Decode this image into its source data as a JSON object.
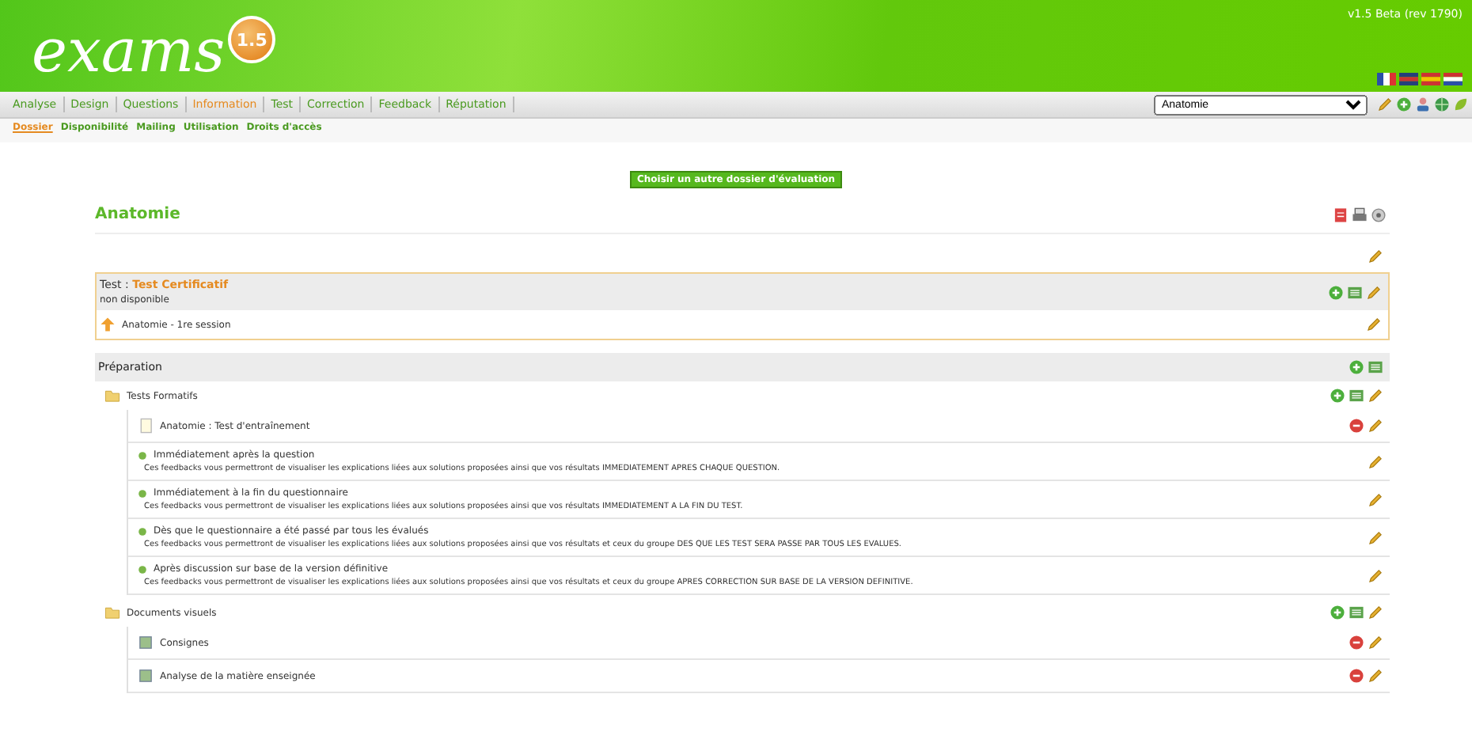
{
  "header": {
    "logo": "exams",
    "version_badge": "1.5",
    "version": "v1.5 Beta (rev 1790)",
    "flags": [
      {
        "kind": "fr"
      },
      {
        "kind": "gb"
      },
      {
        "kind": "es"
      },
      {
        "kind": "nl"
      }
    ]
  },
  "tabs": [
    {
      "label": "Analyse",
      "selected": false
    },
    {
      "label": "Design",
      "selected": false
    },
    {
      "label": "Questions",
      "selected": false
    },
    {
      "label": "Information",
      "selected": true
    },
    {
      "label": "Test",
      "selected": false
    },
    {
      "label": "Correction",
      "selected": false
    },
    {
      "label": "Feedback",
      "selected": false
    },
    {
      "label": "Réputation",
      "selected": false
    }
  ],
  "course_select": {
    "value": "Anatomie"
  },
  "toolbar": [
    {
      "kind": "edit"
    },
    {
      "kind": "add"
    },
    {
      "kind": "user"
    },
    {
      "kind": "globe"
    },
    {
      "kind": "leaf"
    }
  ],
  "subtabs": [
    {
      "label": "Dossier",
      "selected": true
    },
    {
      "label": "Disponibilité",
      "selected": false
    },
    {
      "label": "Mailing",
      "selected": false
    },
    {
      "label": "Utilisation",
      "selected": false
    },
    {
      "label": "Droits d'accès",
      "selected": false
    }
  ],
  "choose_button": "Choisir un autre dossier d'évaluation",
  "title": "Anatomie",
  "title_actions": [
    {
      "kind": "pdf"
    },
    {
      "kind": "print"
    },
    {
      "kind": "view"
    }
  ],
  "test_box": {
    "label": "Test :",
    "name": "Test Certificatif",
    "status": "non disponible",
    "session": "Anatomie - 1re session"
  },
  "preparation": {
    "title": "Préparation",
    "folders": [
      {
        "name": "Tests Formatifs",
        "items": [
          {
            "kind": "test",
            "title": "Anatomie : Test d'entraînement",
            "actions": [
              {
                "kind": "delete"
              },
              {
                "kind": "edit"
              }
            ]
          },
          {
            "kind": "feedback",
            "title": "Immédiatement après la question",
            "description": "Ces feedbacks vous permettront de visualiser les explications liées aux solutions proposées ainsi que vos résultats IMMEDIATEMENT APRES CHAQUE QUESTION.",
            "actions": [
              {
                "kind": "edit"
              }
            ]
          },
          {
            "kind": "feedback",
            "title": "Immédiatement à la fin du questionnaire",
            "description": "Ces feedbacks vous permettront de visualiser les explications liées aux solutions proposées ainsi que vos résultats IMMEDIATEMENT A LA FIN DU TEST.",
            "actions": [
              {
                "kind": "edit"
              }
            ]
          },
          {
            "kind": "feedback",
            "title": "Dès que le questionnaire a été passé par tous les évalués",
            "description": "Ces feedbacks vous permettront de visualiser les explications liées aux solutions proposées ainsi que vos résultats et ceux du groupe DES QUE LES TEST SERA PASSE PAR TOUS LES EVALUES.",
            "actions": [
              {
                "kind": "edit"
              }
            ]
          },
          {
            "kind": "feedback",
            "title": "Après discussion sur base de la version définitive",
            "description": "Ces feedbacks vous permettront de visualiser les explications liées aux solutions proposées ainsi que vos résultats et ceux du groupe APRES CORRECTION SUR BASE DE LA VERSION DEFINITIVE.",
            "actions": [
              {
                "kind": "edit"
              }
            ]
          }
        ]
      },
      {
        "name": "Documents visuels",
        "items": [
          {
            "kind": "document",
            "title": "Consignes",
            "actions": [
              {
                "kind": "delete"
              },
              {
                "kind": "edit"
              }
            ]
          },
          {
            "kind": "document",
            "title": "Analyse de la matière enseignée",
            "actions": [
              {
                "kind": "delete"
              },
              {
                "kind": "edit"
              }
            ]
          }
        ]
      }
    ]
  }
}
